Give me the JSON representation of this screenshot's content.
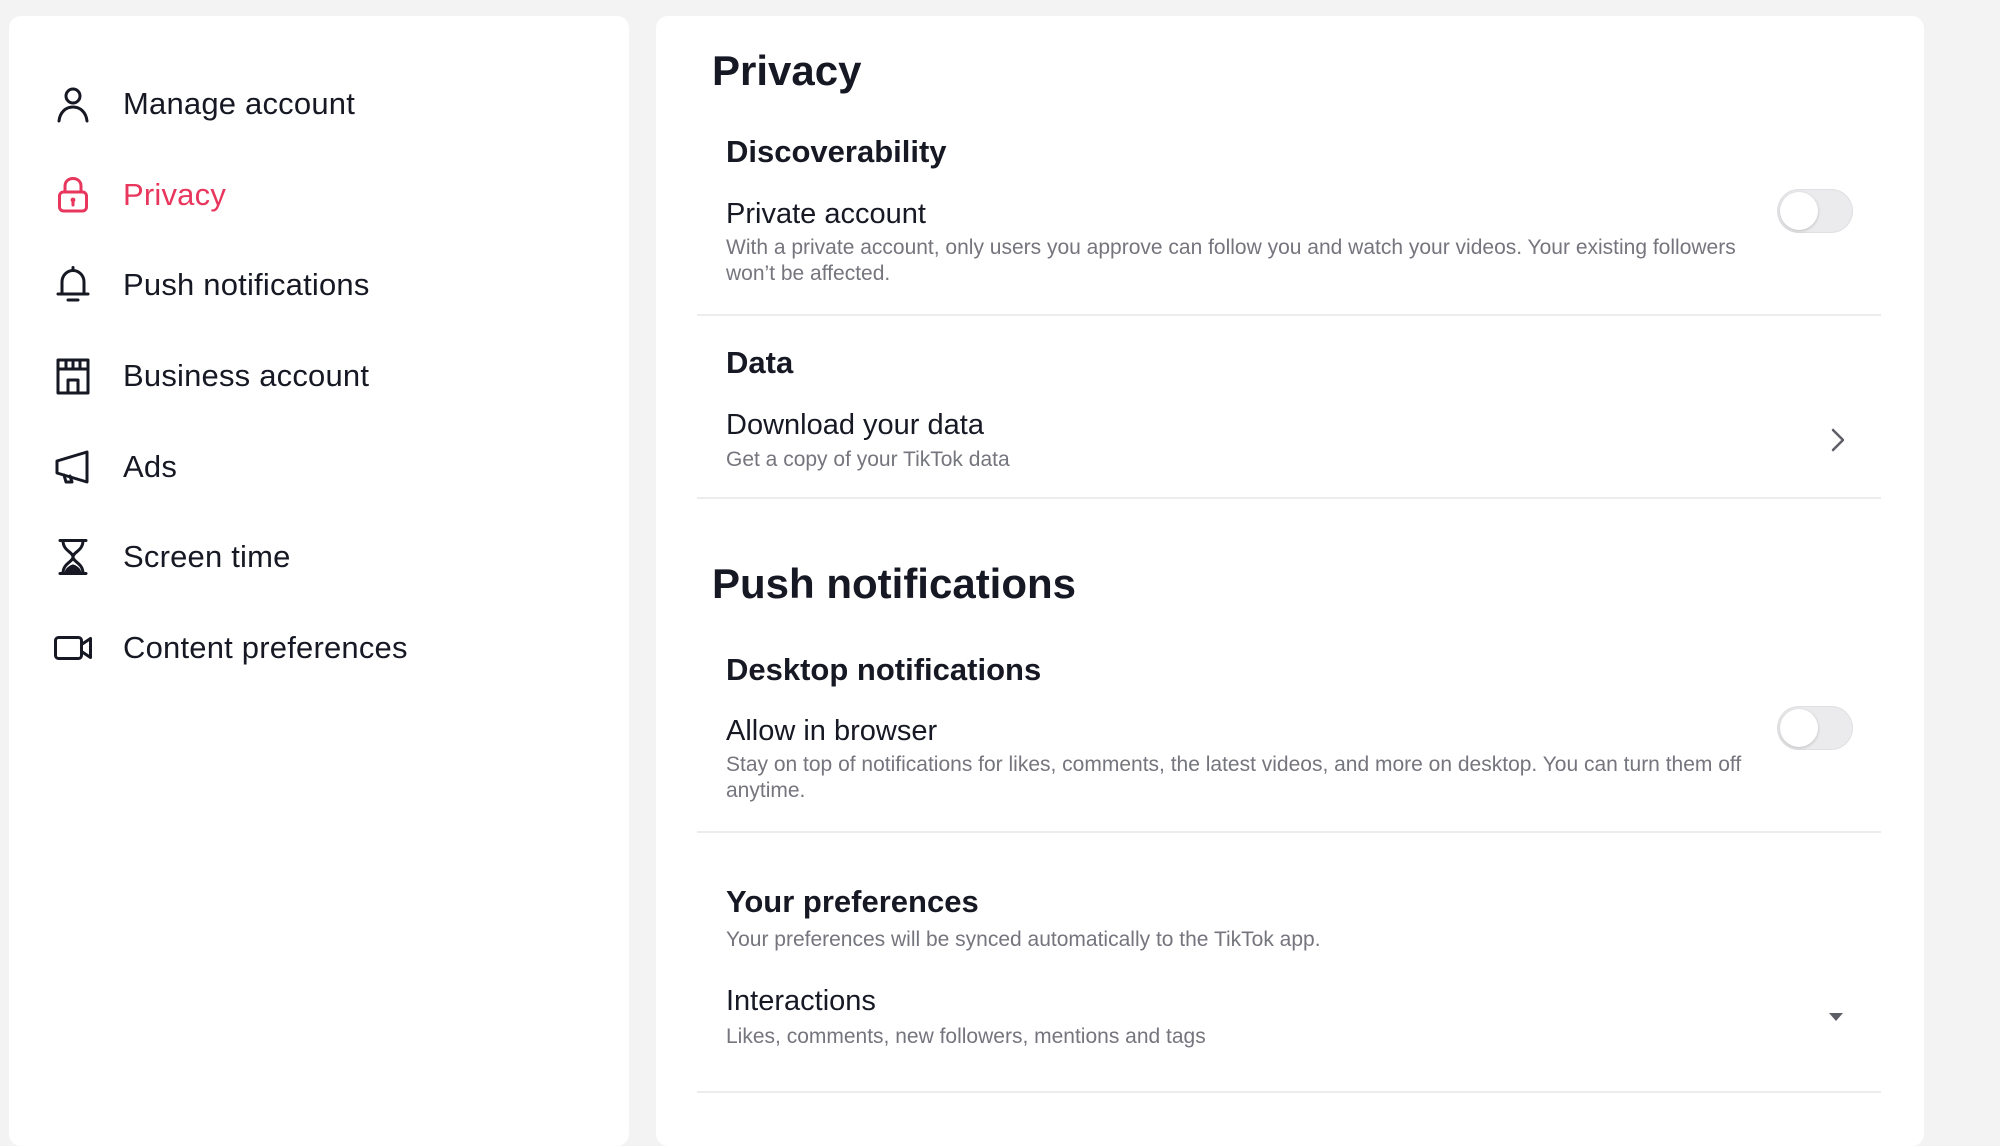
{
  "sidebar": {
    "items": [
      {
        "label": "Manage account",
        "icon": "person-icon",
        "active": false
      },
      {
        "label": "Privacy",
        "icon": "lock-icon",
        "active": true
      },
      {
        "label": "Push notifications",
        "icon": "bell-icon",
        "active": false
      },
      {
        "label": "Business account",
        "icon": "storefront-icon",
        "active": false
      },
      {
        "label": "Ads",
        "icon": "megaphone-icon",
        "active": false
      },
      {
        "label": "Screen time",
        "icon": "hourglass-icon",
        "active": false
      },
      {
        "label": "Content preferences",
        "icon": "video-camera-icon",
        "active": false
      }
    ],
    "active_color": "#e8365d"
  },
  "privacy": {
    "title": "Privacy",
    "discoverability": {
      "heading": "Discoverability",
      "private_account": {
        "title": "Private account",
        "description": "With a private account, only users you approve can follow you and watch your videos. Your existing followers won’t be affected.",
        "enabled": false
      }
    },
    "data": {
      "heading": "Data",
      "download": {
        "title": "Download your data",
        "description": "Get a copy of your TikTok data"
      }
    }
  },
  "push_notifications": {
    "title": "Push notifications",
    "desktop": {
      "heading": "Desktop notifications",
      "allow_in_browser": {
        "title": "Allow in browser",
        "description": "Stay on top of notifications for likes, comments, the latest videos, and more on desktop. You can turn them off anytime.",
        "enabled": false
      }
    },
    "preferences": {
      "heading": "Your preferences",
      "description": "Your preferences will be synced automatically to the TikTok app.",
      "interactions": {
        "title": "Interactions",
        "description": "Likes, comments, new followers, mentions and tags"
      }
    }
  }
}
